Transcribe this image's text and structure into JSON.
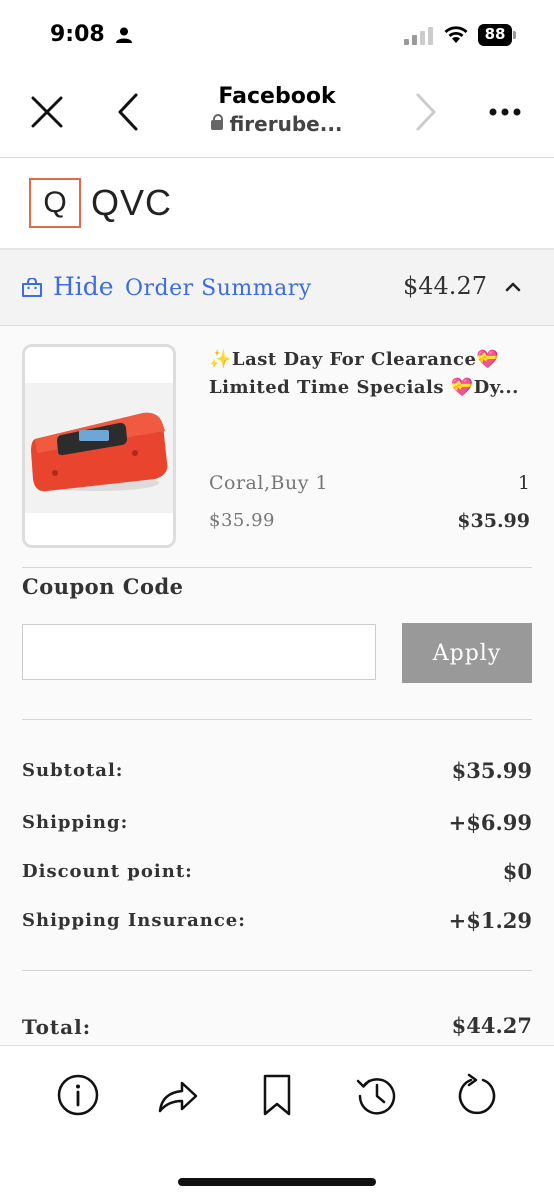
{
  "status_bar": {
    "time": "9:08",
    "battery": "88"
  },
  "browser": {
    "title": "Facebook",
    "url": "firerube..."
  },
  "brand": {
    "logo_letter": "Q",
    "name": "QVC",
    "accent": "#e06a4b"
  },
  "summary_bar": {
    "hide_label": "Hide",
    "order_summary_label": "Order Summary",
    "total": "$44.27"
  },
  "item": {
    "title": "✨Last Day For Clearance💝Limited Time Specials 💝Dy...",
    "variant": "Coral,Buy 1",
    "quantity": "1",
    "unit_price": "$35.99",
    "line_price": "$35.99"
  },
  "coupon": {
    "label": "Coupon Code",
    "value": "",
    "placeholder": "",
    "apply_label": "Apply"
  },
  "totals": {
    "subtotal_label": "Subtotal:",
    "subtotal": "$35.99",
    "shipping_label": "Shipping:",
    "shipping": "+$6.99",
    "discount_label": "Discount point:",
    "discount": "$0",
    "insurance_label": "Shipping Insurance:",
    "insurance": "+$1.29",
    "total_label": "Total:",
    "total": "$44.27"
  },
  "toolbar_icons": [
    "info-icon",
    "share-icon",
    "bookmark-icon",
    "history-icon",
    "reload-icon"
  ]
}
